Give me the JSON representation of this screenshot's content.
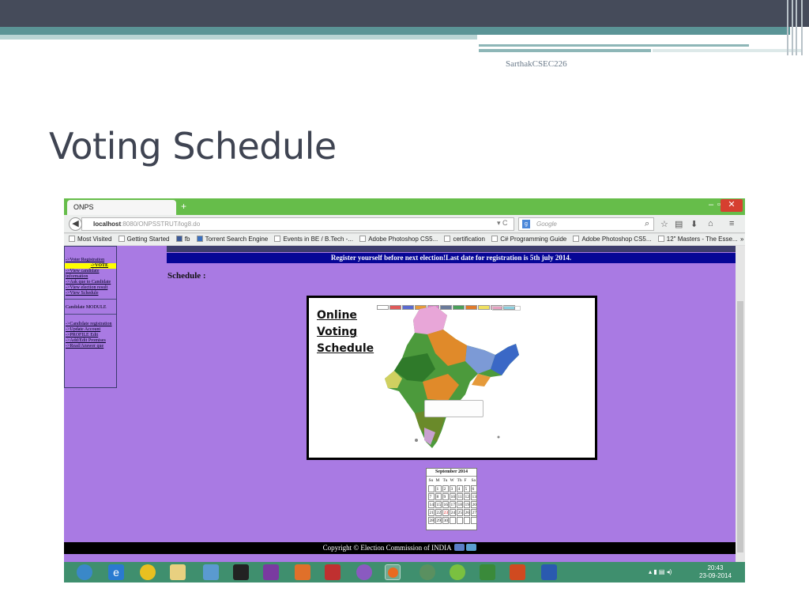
{
  "slide": {
    "author": "SarthakCSEC226",
    "title": "Voting Schedule"
  },
  "browser": {
    "tab_title": "ONPS",
    "new_tab": "+",
    "window_controls": {
      "minimize": "–",
      "maximize": "▫",
      "close": "✕"
    },
    "url_host": "localhost",
    "url_rest": ":8080/ONPSSTRUT/log8.do",
    "search_placeholder": "Google",
    "bookmarks": [
      "Most Visited",
      "Getting Started",
      "fb",
      "Torrent Search Engine",
      "Events in BE / B.Tech -...",
      "Adobe Photoshop CS5...",
      "certification",
      "C# Programming Guide",
      "Adobe Photoshop CS5...",
      "12\" Masters - The Esse..."
    ],
    "bookmarks_more": "»"
  },
  "webpage": {
    "banner": "Register yourself before next election!Last date for registration is 5th july 2014.",
    "schedule_label": "Schedule :",
    "sidebar": {
      "voter_links": [
        "->Voter Registration",
        "->VOTE",
        "->View candidate information",
        "->Ask que to Candidate",
        "->View election result",
        "->View Schedule"
      ],
      "candidate_heading": "Candidate MODULE",
      "candidate_links": [
        "->Candidate registration",
        "->Update Account",
        "->PROFILE Edit",
        "->Add/Edit Promises",
        "->Read/Answer que"
      ]
    },
    "map_image": {
      "title_lines": [
        "Online",
        "Voting",
        "Schedule"
      ],
      "legend_colors": [
        "#ffffff",
        "#e05a5a",
        "#5a6ad0",
        "#e59a3a",
        "#e07ad0",
        "#6a7a9a",
        "#4aa05a",
        "#e07a2a",
        "#f0e060",
        "#e8a0c0",
        "#8ad0e0"
      ]
    },
    "calendar": {
      "month": "September 2014",
      "days_of_week": [
        "Su",
        "M",
        "Tu",
        "W",
        "Th",
        "F",
        "Sa"
      ],
      "weeks": [
        [
          "",
          "1",
          "2",
          "3",
          "4",
          "5",
          "6"
        ],
        [
          "7",
          "8",
          "9",
          "10",
          "11",
          "12",
          "13"
        ],
        [
          "14",
          "15",
          "16",
          "17",
          "18",
          "19",
          "20"
        ],
        [
          "21",
          "22",
          "23",
          "24",
          "25",
          "26",
          "27"
        ],
        [
          "28",
          "29",
          "30",
          "",
          "",
          "",
          ""
        ]
      ],
      "today": "23"
    },
    "footer": "Copyright © Election Commission of INDIA"
  },
  "taskbar": {
    "time": "20:43",
    "date": "23-09-2014"
  }
}
